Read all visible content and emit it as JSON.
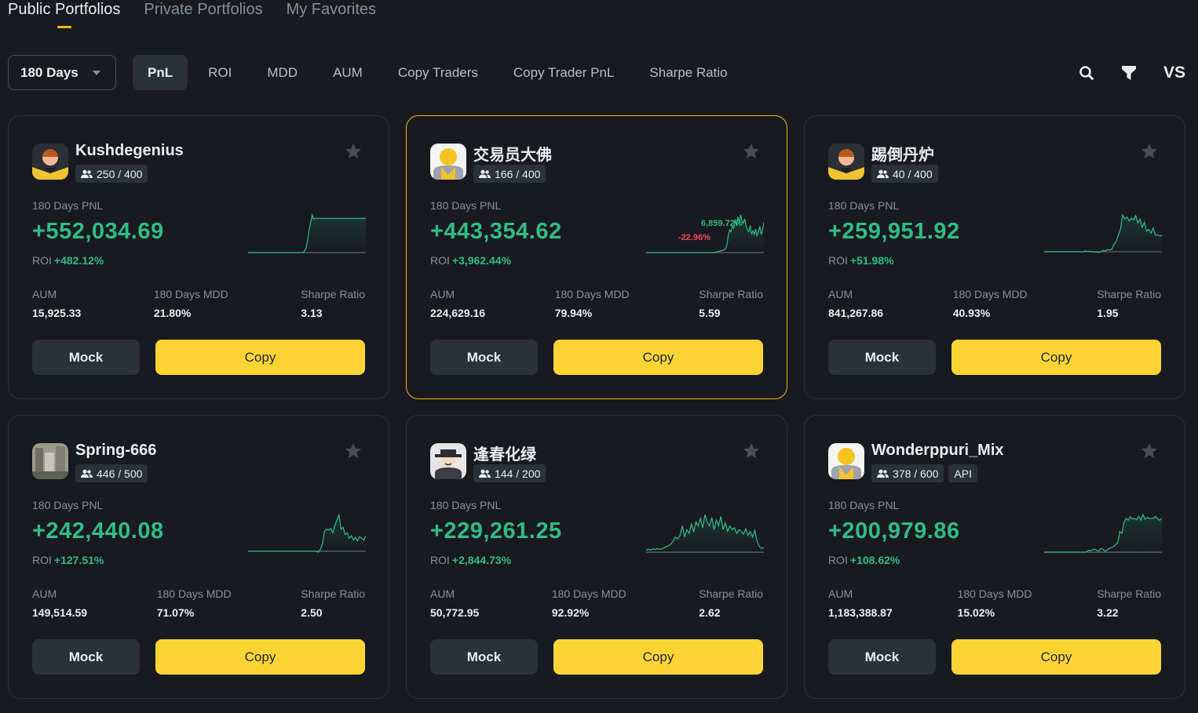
{
  "top_tabs": [
    {
      "label": "Public Portfolios",
      "active": true
    },
    {
      "label": "Private Portfolios",
      "active": false
    },
    {
      "label": "My Favorites",
      "active": false
    }
  ],
  "filter": {
    "period_value": "180 Days",
    "sort_tabs": [
      {
        "label": "PnL",
        "active": true
      },
      {
        "label": "ROI",
        "active": false
      },
      {
        "label": "MDD",
        "active": false
      },
      {
        "label": "AUM",
        "active": false
      },
      {
        "label": "Copy Traders",
        "active": false
      },
      {
        "label": "Copy Trader PnL",
        "active": false
      },
      {
        "label": "Sharpe Ratio",
        "active": false
      }
    ],
    "icons": [
      "search-icon",
      "filter-icon",
      "vs-icon"
    ],
    "vs_label": "VS"
  },
  "labels": {
    "pnl": "180 Days PNL",
    "roi": "ROI",
    "aum": "AUM",
    "mdd": "180 Days MDD",
    "sharpe": "Sharpe Ratio",
    "mock": "Mock",
    "copy": "Copy",
    "api": "API"
  },
  "colors": {
    "accent": "#fcd535",
    "positive": "#2ebd85",
    "negative": "#f6465d",
    "background": "#181a20",
    "highlight_border": "#f0b90b"
  },
  "cards": [
    {
      "name": "Kushdegenius",
      "avatar": "avatar-person-dark",
      "copiers": "250 / 400",
      "pnl": "+552,034.69",
      "roi": "+482.12%",
      "aum": "15,925.33",
      "mdd": "21.80%",
      "sharpe": "3.13",
      "highlight": false,
      "api": false,
      "spark": [
        0,
        0,
        0,
        0,
        0,
        0,
        0,
        0,
        0,
        0,
        0,
        0,
        0,
        0,
        0,
        0,
        0,
        0,
        0,
        0,
        0,
        0,
        0,
        0,
        0,
        0,
        0,
        0,
        0,
        0,
        0,
        0,
        0,
        0,
        0,
        0,
        0,
        0,
        5,
        12,
        30,
        55,
        72,
        90,
        80,
        82,
        82,
        82,
        82,
        82,
        82,
        82,
        82,
        82,
        82,
        82,
        82,
        82,
        82,
        82,
        82,
        82,
        82,
        82,
        82,
        82,
        82,
        82,
        82,
        82,
        82,
        82,
        82,
        82,
        82,
        82,
        82,
        82,
        82,
        82
      ]
    },
    {
      "name": "交易员大佛",
      "avatar": "avatar-person-light",
      "copiers": "166 / 400",
      "pnl": "+443,354.62",
      "roi": "+3,962.44%",
      "aum": "224,629.16",
      "mdd": "79.94%",
      "sharpe": "5.59",
      "highlight": true,
      "api": false,
      "tooltip_high": "6,859.72%",
      "tooltip_low": "-22.96%",
      "spark": [
        0,
        0,
        0,
        0,
        0,
        0,
        0,
        0,
        0,
        0,
        0,
        0,
        0,
        0,
        0,
        0,
        0,
        0,
        0,
        0,
        0,
        0,
        0,
        0,
        0,
        0,
        0,
        0,
        0,
        0,
        0,
        0,
        0,
        0,
        0,
        0,
        0,
        0,
        0,
        0,
        0,
        0,
        0,
        0,
        0,
        0,
        0,
        0,
        0,
        0,
        0,
        2,
        1,
        4,
        3,
        6,
        5,
        8,
        10,
        20,
        45,
        60,
        55,
        70,
        65,
        88,
        72,
        95,
        80,
        100,
        85,
        78,
        90,
        70,
        60,
        55,
        72,
        50,
        58,
        48,
        62,
        45,
        55,
        70,
        48,
        60,
        80
      ]
    },
    {
      "name": "踢倒丹炉",
      "avatar": "avatar-person-dark",
      "copiers": "40 / 400",
      "pnl": "+259,951.92",
      "roi": "+51.98%",
      "aum": "841,267.86",
      "mdd": "40.93%",
      "sharpe": "1.95",
      "highlight": false,
      "api": false,
      "spark": [
        0,
        0,
        0,
        0,
        0,
        0,
        0,
        0,
        0,
        0,
        0,
        0,
        0,
        0,
        0,
        0,
        0,
        0,
        0,
        2,
        0,
        1,
        0,
        -1,
        0,
        -2,
        0,
        3,
        2,
        5,
        4,
        6,
        18,
        25,
        40,
        55,
        90,
        80,
        85,
        75,
        82,
        78,
        88,
        70,
        80,
        60,
        72,
        50,
        55,
        45,
        58,
        40,
        42,
        38,
        40
      ]
    },
    {
      "name": "Spring-666",
      "avatar": "avatar-photo",
      "copiers": "446 / 500",
      "pnl": "+242,440.08",
      "roi": "+127.51%",
      "aum": "149,514.59",
      "mdd": "71.07%",
      "sharpe": "2.50",
      "highlight": false,
      "api": false,
      "spark": [
        0,
        0,
        0,
        0,
        0,
        0,
        0,
        0,
        0,
        0,
        0,
        0,
        0,
        0,
        0,
        0,
        0,
        0,
        0,
        0,
        0,
        0,
        0,
        0,
        0,
        0,
        0,
        0,
        0,
        0,
        0,
        0,
        0,
        0,
        -3,
        5,
        20,
        55,
        60,
        58,
        62,
        50,
        70,
        85,
        100,
        60,
        65,
        45,
        50,
        35,
        42,
        30,
        38,
        28,
        40,
        35,
        30,
        42
      ]
    },
    {
      "name": "逢春化绿",
      "avatar": "avatar-hat",
      "copiers": "144 / 200",
      "pnl": "+229,261.25",
      "roi": "+2,844.73%",
      "aum": "50,772.95",
      "mdd": "92.92%",
      "sharpe": "2.62",
      "highlight": false,
      "api": false,
      "spark": [
        5,
        8,
        6,
        9,
        7,
        10,
        8,
        9,
        12,
        15,
        18,
        22,
        30,
        40,
        35,
        45,
        70,
        40,
        60,
        50,
        75,
        55,
        80,
        70,
        90,
        65,
        100,
        80,
        70,
        92,
        60,
        85,
        70,
        95,
        60,
        78,
        55,
        70,
        60,
        65,
        50,
        60,
        55,
        48,
        62,
        45,
        55,
        40,
        58,
        30,
        15,
        10,
        12
      ]
    },
    {
      "name": "Wonderppuri_Mix",
      "avatar": "avatar-person-light",
      "copiers": "378 / 600",
      "pnl": "+200,979.86",
      "roi": "+108.62%",
      "aum": "1,183,388.87",
      "mdd": "15.02%",
      "sharpe": "3.22",
      "highlight": false,
      "api": true,
      "spark": [
        0,
        0,
        0,
        0,
        0,
        0,
        0,
        0,
        0,
        0,
        0,
        0,
        0,
        0,
        0,
        0,
        0,
        0,
        0,
        0,
        0,
        5,
        4,
        6,
        8,
        5,
        3,
        10,
        8,
        2,
        6,
        10,
        12,
        15,
        20,
        25,
        55,
        50,
        80,
        90,
        85,
        95,
        88,
        90,
        86,
        95,
        85,
        100,
        88,
        92,
        90,
        90,
        90,
        95,
        88,
        85,
        90
      ]
    }
  ]
}
